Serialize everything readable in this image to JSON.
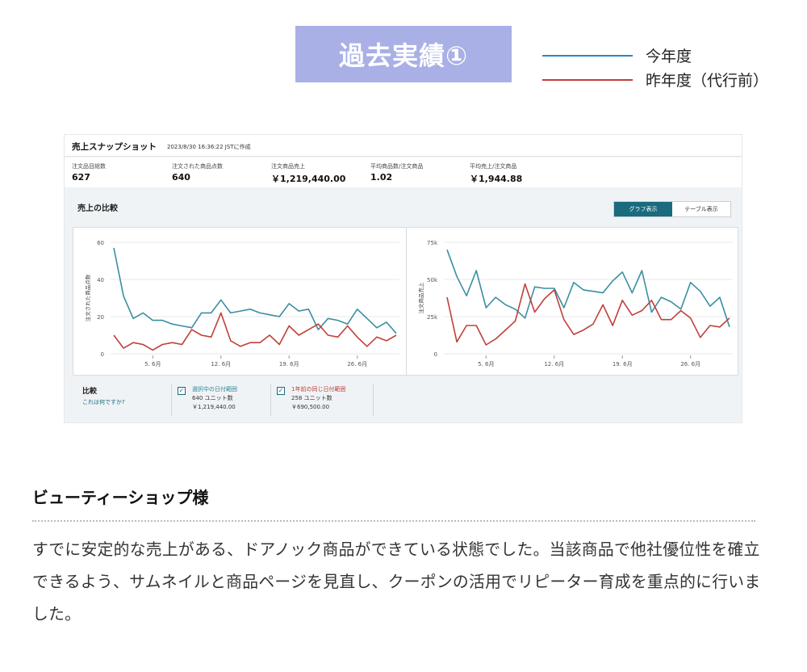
{
  "header": {
    "title": "過去実績①",
    "legend": [
      {
        "label": "今年度",
        "color": "#2a88c4"
      },
      {
        "label": "昨年度（代行前）",
        "color": "#c0403a"
      }
    ]
  },
  "snapshot": {
    "title": "売上スナップショット",
    "generated": "2023/8/30 16:36:22 JSTに作成",
    "metrics": [
      {
        "label": "注文品目総数",
        "value": "627"
      },
      {
        "label": "注文された商品点数",
        "value": "640"
      },
      {
        "label": "注文商品売上",
        "value": "￥1,219,440.00"
      },
      {
        "label": "平均商品数/注文商品",
        "value": "1.02"
      },
      {
        "label": "平均売上/注文商品",
        "value": "￥1,944.88"
      }
    ],
    "compare_title": "売上の比較",
    "toggle": {
      "graph": "グラフ表示",
      "table": "テーブル表示"
    },
    "comparison": {
      "label": "比較",
      "help_link": "これは何ですか?",
      "current": {
        "title": "選択中の日付範囲",
        "units": "640 ユニット数",
        "sales": "￥1,219,440.00",
        "color": "#2a8a96"
      },
      "previous": {
        "title": "1年前の同じ日付範囲",
        "units": "258 ユニット数",
        "sales": "￥690,500.00",
        "color": "#c0403a"
      }
    }
  },
  "chart_data": [
    {
      "type": "line",
      "ylabel": "注文された商品点数",
      "ylim": [
        0,
        60
      ],
      "yticks": [
        "0",
        "20",
        "40",
        "60"
      ],
      "xticks": [
        "5. 6月",
        "12. 6月",
        "19. 6月",
        "26. 6月"
      ],
      "grid": true,
      "series": [
        {
          "name": "選択中の日付範囲",
          "color": "#3a8fa0",
          "values": [
            57,
            31,
            19,
            22,
            18,
            18,
            16,
            15,
            14,
            22,
            22,
            29,
            22,
            23,
            24,
            22,
            21,
            20,
            27,
            23,
            24,
            13,
            19,
            18,
            16,
            24,
            19,
            14,
            17,
            11
          ]
        },
        {
          "name": "1年前の同じ日付範囲",
          "color": "#c0403a",
          "values": [
            10,
            3,
            6,
            5,
            2,
            5,
            6,
            5,
            13,
            10,
            9,
            22,
            7,
            4,
            6,
            6,
            10,
            5,
            15,
            10,
            13,
            16,
            10,
            9,
            15,
            9,
            4,
            9,
            7,
            10
          ]
        }
      ]
    },
    {
      "type": "line",
      "ylabel": "注文商品売上",
      "ylim": [
        0,
        75000
      ],
      "yticks": [
        "0",
        "25k",
        "50k",
        "75k"
      ],
      "xticks": [
        "5. 6月",
        "12. 6月",
        "19. 6月",
        "26. 6月"
      ],
      "grid": true,
      "series": [
        {
          "name": "選択中の日付範囲",
          "color": "#3a8fa0",
          "values": [
            70000,
            52000,
            39000,
            56000,
            31000,
            38000,
            33000,
            30000,
            24000,
            45000,
            44000,
            44000,
            31000,
            48000,
            43000,
            42000,
            41000,
            49000,
            55000,
            41000,
            56000,
            28000,
            38000,
            35000,
            30000,
            48000,
            42000,
            32000,
            38000,
            18000
          ]
        },
        {
          "name": "1年前の同じ日付範囲",
          "color": "#c0403a",
          "values": [
            38000,
            8000,
            19000,
            19000,
            6000,
            10000,
            16000,
            22000,
            47000,
            28000,
            37000,
            43000,
            23000,
            13000,
            16000,
            20000,
            33000,
            19000,
            36000,
            26000,
            29000,
            36000,
            23000,
            23000,
            29000,
            24000,
            11000,
            19000,
            18000,
            24000
          ]
        }
      ]
    }
  ],
  "shop": {
    "title": "ビューティーショップ様",
    "description": "すでに安定的な売上がある、ドアノック商品ができている状態でした。当該商品で他社優位性を確立できるよう、サムネイルと商品ページを見直し、クーポンの活用でリピーター育成を重点的に行いました。"
  }
}
